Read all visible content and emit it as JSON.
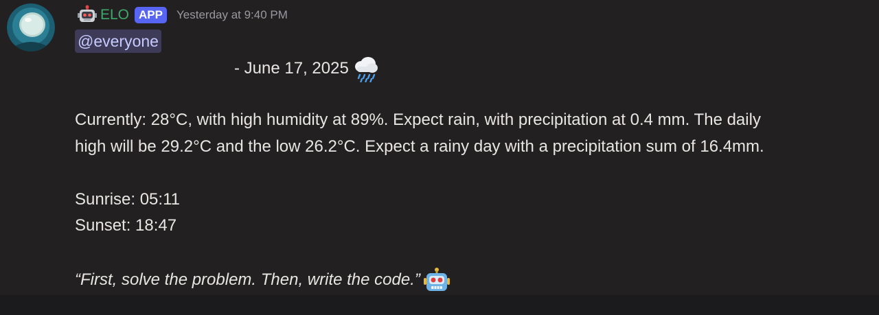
{
  "message": {
    "author": {
      "name": "ELO",
      "tag": "APP",
      "avatar_icon": "astronaut-helmet-avatar",
      "badge_icon": "robot-icon"
    },
    "timestamp": "Yesterday at 9:40 PM",
    "mention": "@everyone",
    "date_line": "- June 17, 2025",
    "date_emoji": "rain-cloud-icon",
    "body_line_1": "Currently: 28°C, with high humidity at 89%. Expect rain, with precipitation at 0.4 mm. The daily",
    "body_line_2": "high will be 29.2°C and the low 26.2°C. Expect a rainy day with a precipitation sum of 16.4mm.",
    "sunrise": "Sunrise: 05:11",
    "sunset": "Sunset: 18:47",
    "quote": "“First, solve the problem. Then, write the code.”",
    "quote_emoji": "robot-icon"
  },
  "colors": {
    "background": "#232021",
    "username": "#3fa86b",
    "app_tag": "#5865f2",
    "mention_bg": "#3d3b57",
    "mention_text": "#c7caff",
    "timestamp": "#9a989f"
  }
}
